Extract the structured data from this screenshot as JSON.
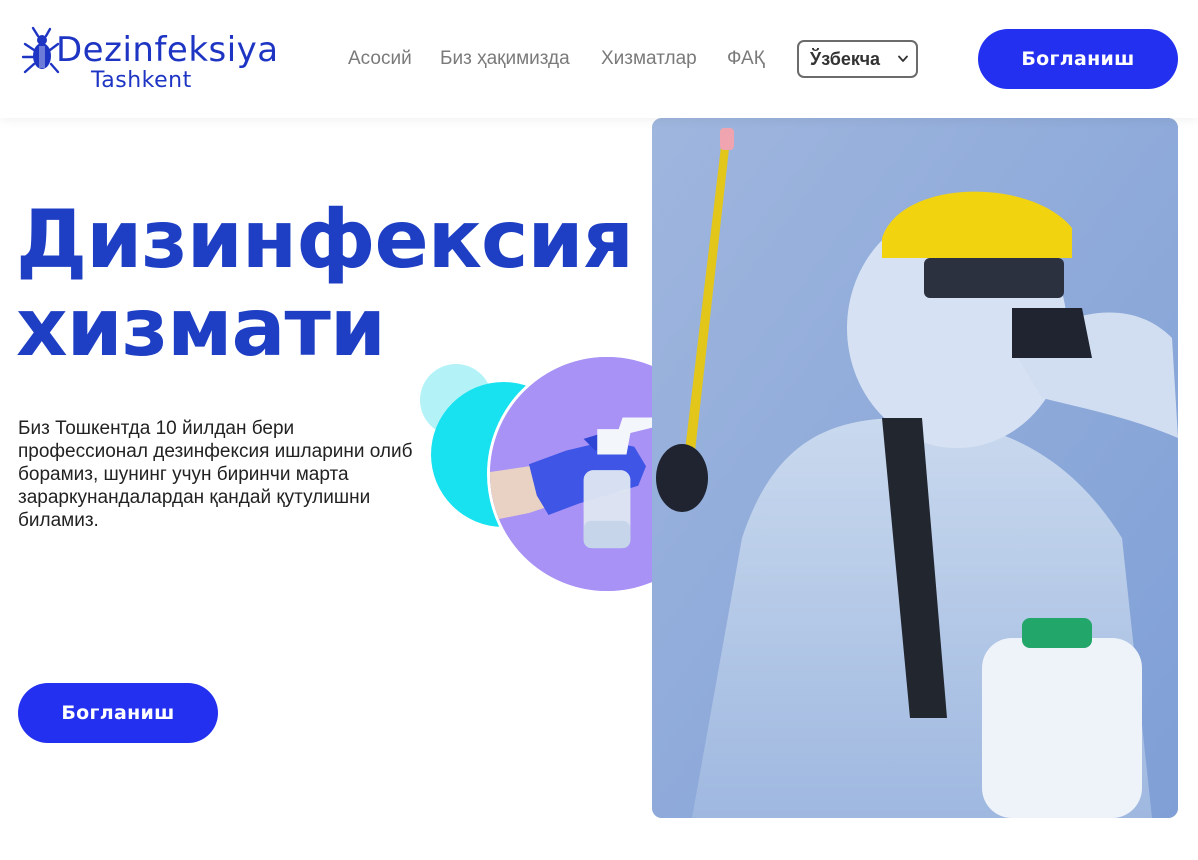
{
  "header": {
    "logo": {
      "word": "Dezinfeksiya",
      "sub": "Tashkent",
      "icon": "bug-icon"
    },
    "nav": [
      {
        "label": "Асосий"
      },
      {
        "label": "Биз ҳақимизда"
      },
      {
        "label": "Хизматлар"
      },
      {
        "label": "ФАҚ"
      }
    ],
    "language": {
      "selected": "Ўзбекча"
    },
    "contact_button": "Богланиш"
  },
  "hero": {
    "title_line1": "Дизинфексия",
    "title_line2": "хизмати",
    "description": "Биз Тошкентда 10 йилдан бери профессионал дезинфексия ишларини олиб борамиз, шунинг учун биринчи марта зараркунандалардан қандай қутулишни биламиз.",
    "contact_button": "Богланиш",
    "photo": "disinfection-worker-photo",
    "circle_image": "gloved-hand-spray-bottle-photo"
  },
  "colors": {
    "brand_blue": "#1e3fc4",
    "button_blue": "#2330f0",
    "circle_cyan": "#18e2f0",
    "circle_purple": "#a892f5"
  }
}
